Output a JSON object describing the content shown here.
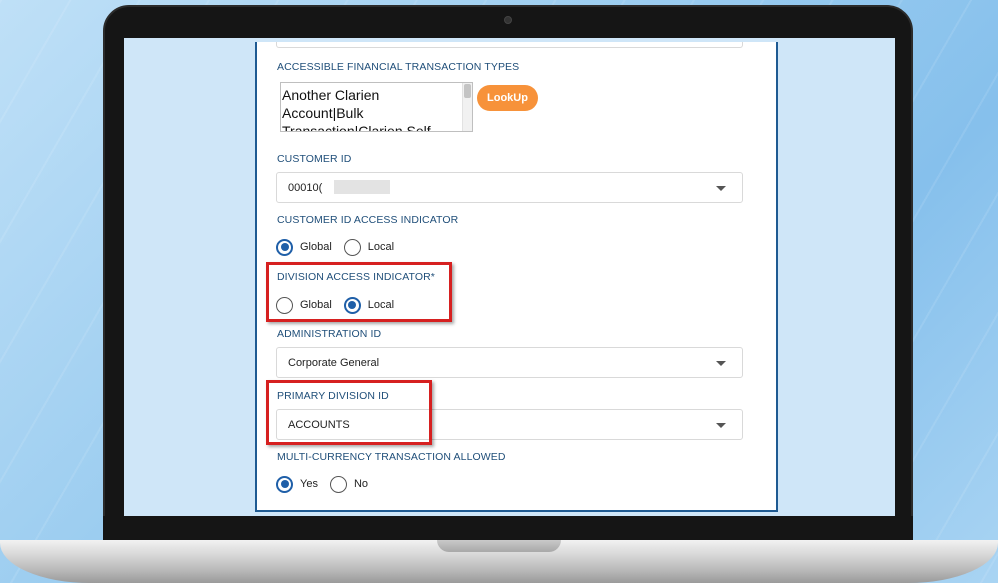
{
  "form": {
    "accessible_types_label": "ACCESSIBLE FINANCIAL TRANSACTION TYPES",
    "accessible_types_value": "Another Clarien Account|Bulk Transaction|Clarien Self Transfer|Direct Debit File",
    "lookup_button": "LookUp",
    "customer_id_label": "CUSTOMER ID",
    "customer_id_value": "00010(",
    "customer_id_access_label": "CUSTOMER ID ACCESS INDICATOR",
    "customer_id_access_options": [
      "Global",
      "Local"
    ],
    "customer_id_access_selected": "Global",
    "division_access_label": "DIVISION ACCESS INDICATOR*",
    "division_access_options": [
      "Global",
      "Local"
    ],
    "division_access_selected": "Local",
    "administration_id_label": "ADMINISTRATION ID",
    "administration_id_value": "Corporate General",
    "primary_division_label": "PRIMARY DIVISION ID",
    "primary_division_value": "ACCOUNTS",
    "multicurrency_label": "MULTI-CURRENCY TRANSACTION ALLOWED",
    "multicurrency_options": [
      "Yes",
      "No"
    ],
    "multicurrency_selected": "Yes"
  },
  "colors": {
    "label_blue": "#1f4e79",
    "accent_orange": "#f7923a",
    "radio_blue": "#1f5fa8",
    "highlight_red": "#d62020"
  }
}
